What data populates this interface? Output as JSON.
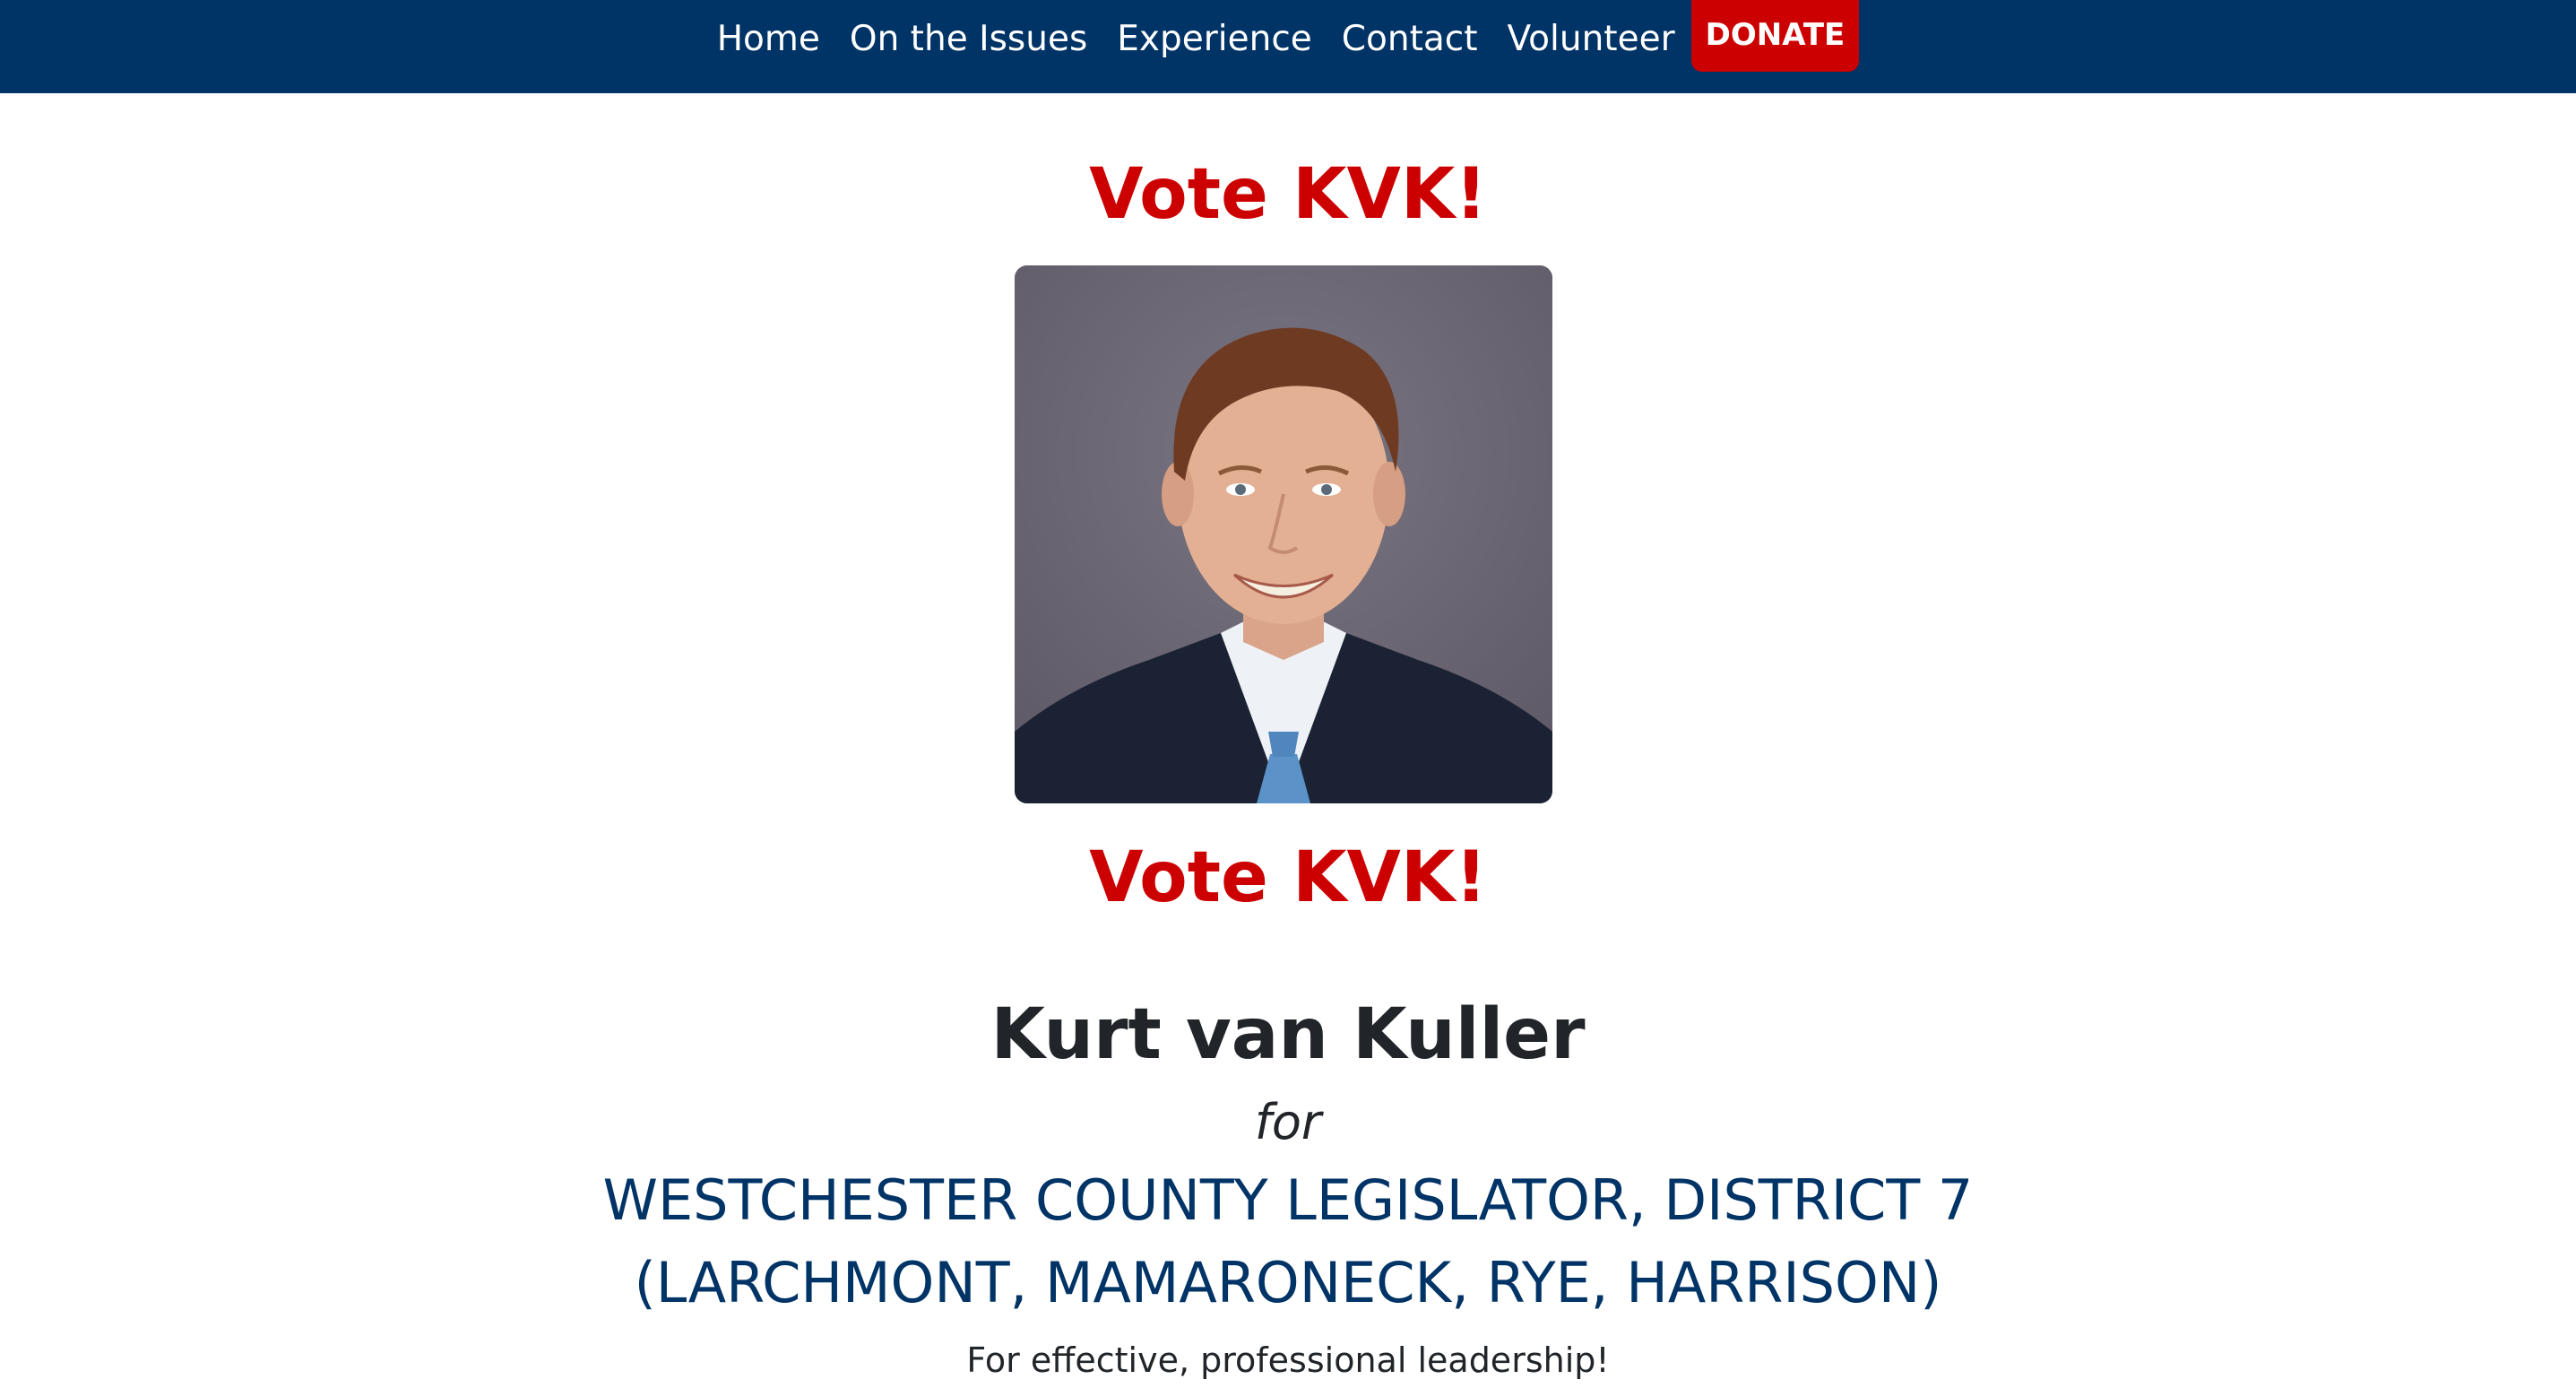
{
  "nav": {
    "items": [
      {
        "label": "Home"
      },
      {
        "label": "On the Issues"
      },
      {
        "label": "Experience"
      },
      {
        "label": "Contact"
      },
      {
        "label": "Volunteer"
      }
    ],
    "donate_label": "DONATE"
  },
  "hero": {
    "vote_top": "Vote KVK!",
    "vote_bottom": "Vote KVK!",
    "candidate_name": "Kurt van Kuller",
    "for_text": "for",
    "office_line1": "WESTCHESTER COUNTY LEGISLATOR, DISTRICT 7",
    "office_line2": "(LARCHMONT, MAMARONECK, RYE, HARRISON)",
    "tagline": "For effective, professional leadership!"
  },
  "colors": {
    "navbar": "#003366",
    "accent_red": "#cc0000",
    "office_text": "#003366"
  }
}
